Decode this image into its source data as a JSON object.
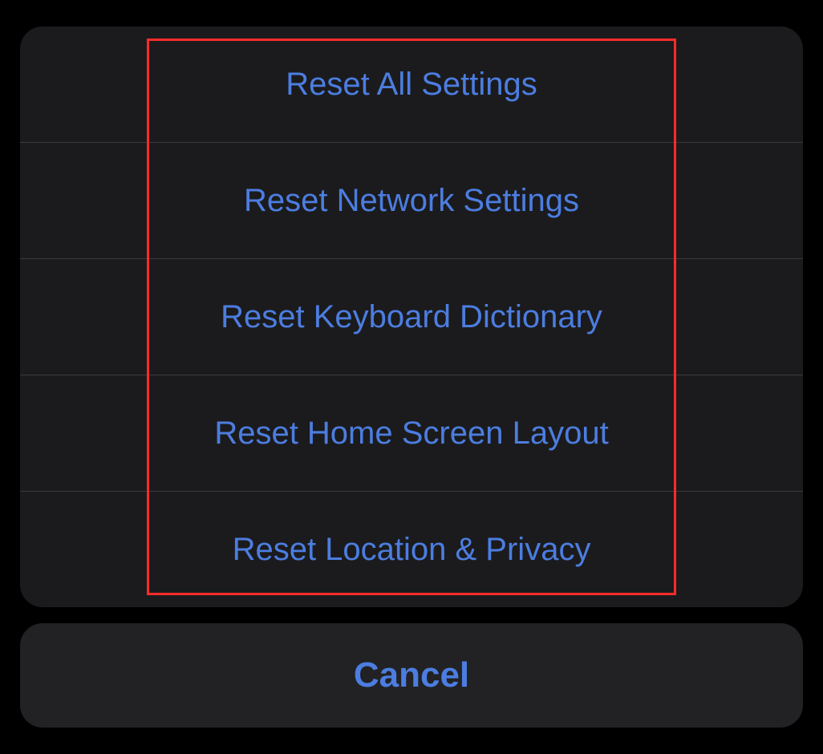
{
  "actionSheet": {
    "options": [
      {
        "label": "Reset All Settings"
      },
      {
        "label": "Reset Network Settings"
      },
      {
        "label": "Reset Keyboard Dictionary"
      },
      {
        "label": "Reset Home Screen Layout"
      },
      {
        "label": "Reset Location & Privacy"
      }
    ],
    "cancel_label": "Cancel"
  }
}
